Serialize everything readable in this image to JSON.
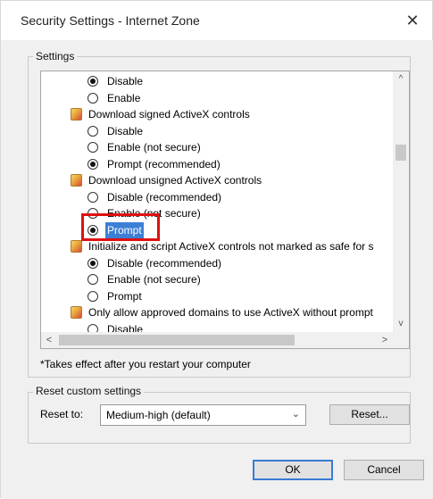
{
  "window": {
    "title": "Security Settings - Internet Zone",
    "close_glyph": "✕"
  },
  "settings_group": {
    "legend": "Settings",
    "options": [
      {
        "type": "radio",
        "label": "Disable",
        "checked": true,
        "selected": false
      },
      {
        "type": "radio",
        "label": "Enable",
        "checked": false,
        "selected": false
      },
      {
        "type": "heading",
        "label": "Download signed ActiveX controls",
        "icon": "settings-shield-icon"
      },
      {
        "type": "radio",
        "label": "Disable",
        "checked": false,
        "selected": false
      },
      {
        "type": "radio",
        "label": "Enable (not secure)",
        "checked": false,
        "selected": false
      },
      {
        "type": "radio",
        "label": "Prompt (recommended)",
        "checked": true,
        "selected": false
      },
      {
        "type": "heading",
        "label": "Download unsigned ActiveX controls",
        "icon": "settings-shield-icon"
      },
      {
        "type": "radio",
        "label": "Disable (recommended)",
        "checked": false,
        "selected": false
      },
      {
        "type": "radio",
        "label": "Enable (not secure)",
        "checked": false,
        "selected": false
      },
      {
        "type": "radio",
        "label": "Prompt",
        "checked": true,
        "selected": true
      },
      {
        "type": "heading",
        "label": "Initialize and script ActiveX controls not marked as safe for s",
        "icon": "settings-shield-icon"
      },
      {
        "type": "radio",
        "label": "Disable (recommended)",
        "checked": true,
        "selected": false
      },
      {
        "type": "radio",
        "label": "Enable (not secure)",
        "checked": false,
        "selected": false
      },
      {
        "type": "radio",
        "label": "Prompt",
        "checked": false,
        "selected": false
      },
      {
        "type": "heading",
        "label": "Only allow approved domains to use ActiveX without prompt",
        "icon": "settings-shield-icon"
      },
      {
        "type": "radio",
        "label": "Disable",
        "checked": false,
        "selected": false
      }
    ],
    "scroll_up_glyph": "^",
    "scroll_down_glyph": "v",
    "scroll_left_glyph": "<",
    "scroll_right_glyph": ">"
  },
  "note": "*Takes effect after you restart your computer",
  "reset_group": {
    "legend": "Reset custom settings",
    "reset_to_label": "Reset to:",
    "dropdown_value": "Medium-high (default)",
    "dropdown_chevron": "⌄",
    "reset_button": "Reset..."
  },
  "buttons": {
    "ok": "OK",
    "cancel": "Cancel"
  },
  "colors": {
    "selection": "#3c7fd5",
    "highlight_box": "#e01010",
    "default_button_border": "#3a7bd5"
  }
}
